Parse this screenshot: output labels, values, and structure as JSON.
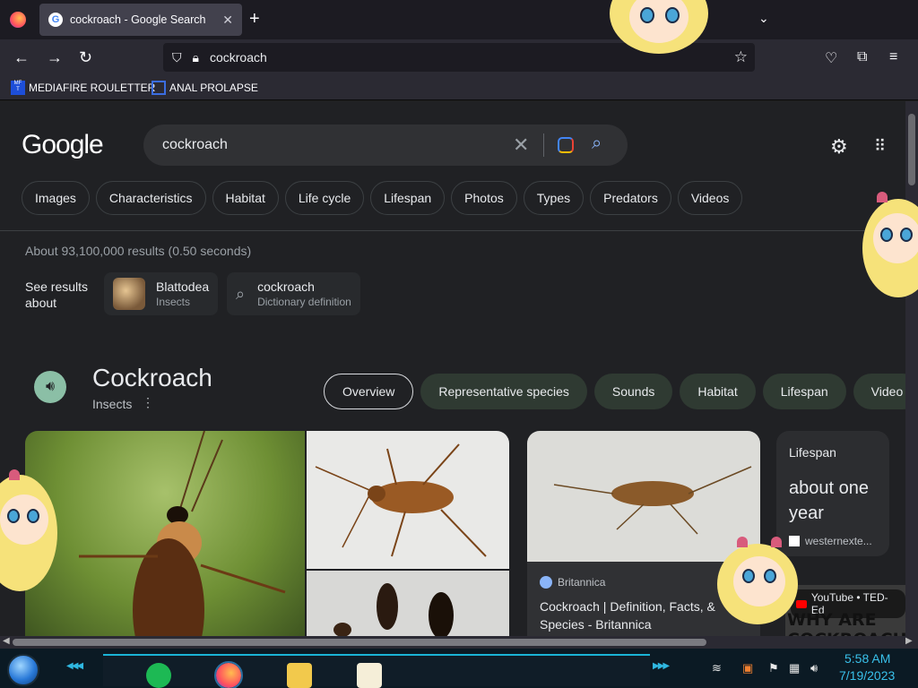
{
  "browser": {
    "tab_title": "cockroach - Google Search",
    "url": "cockroach",
    "bookmarks": [
      "MEDIAFIRE ROULETTER",
      "ANAL PROLAPSE"
    ],
    "bookmark_icon_text": "MF\nT"
  },
  "google": {
    "logo": "Google",
    "query": "cockroach",
    "chips": [
      "Images",
      "Characteristics",
      "Habitat",
      "Life cycle",
      "Lifespan",
      "Photos",
      "Types",
      "Predators",
      "Videos"
    ],
    "stats": "About 93,100,000 results (0.50 seconds)",
    "see_results_label": "See results about",
    "see_results": [
      {
        "title": "Blattodea",
        "subtitle": "Insects"
      },
      {
        "title": "cockroach",
        "subtitle": "Dictionary definition"
      }
    ]
  },
  "knowledge_panel": {
    "title": "Cockroach",
    "subtitle": "Insects",
    "tabs": [
      "Overview",
      "Representative species",
      "Sounds",
      "Habitat",
      "Lifespan",
      "Video"
    ],
    "active_tab": "Overview",
    "britannica_source": "Britannica",
    "britannica_title": "Cockroach | Definition, Facts, & Species - Britannica",
    "lifespan_label": "Lifespan",
    "lifespan_value": "about one year",
    "lifespan_source": "westernexte...",
    "youtube_source": "YouTube • TED-Ed",
    "youtube_thumb_text": "WHY ARE COCKROACHE"
  },
  "taskbar": {
    "time": "5:58 AM",
    "date": "7/19/2023"
  },
  "colors": {
    "accent": "#8ab4f8",
    "page_bg": "#202124",
    "taskbar_accent": "#39c0ea"
  },
  "icons": [
    "firefox-icon",
    "google-favicon",
    "close-icon",
    "plus-icon",
    "chevron-down-icon",
    "back-icon",
    "forward-icon",
    "reload-icon",
    "shield-icon",
    "lock-icon",
    "star-icon",
    "pocket-icon",
    "extensions-icon",
    "menu-icon",
    "search-icon",
    "lens-icon",
    "gear-icon",
    "apps-icon",
    "speaker-icon",
    "more-vert-icon",
    "start-orb-icon"
  ]
}
